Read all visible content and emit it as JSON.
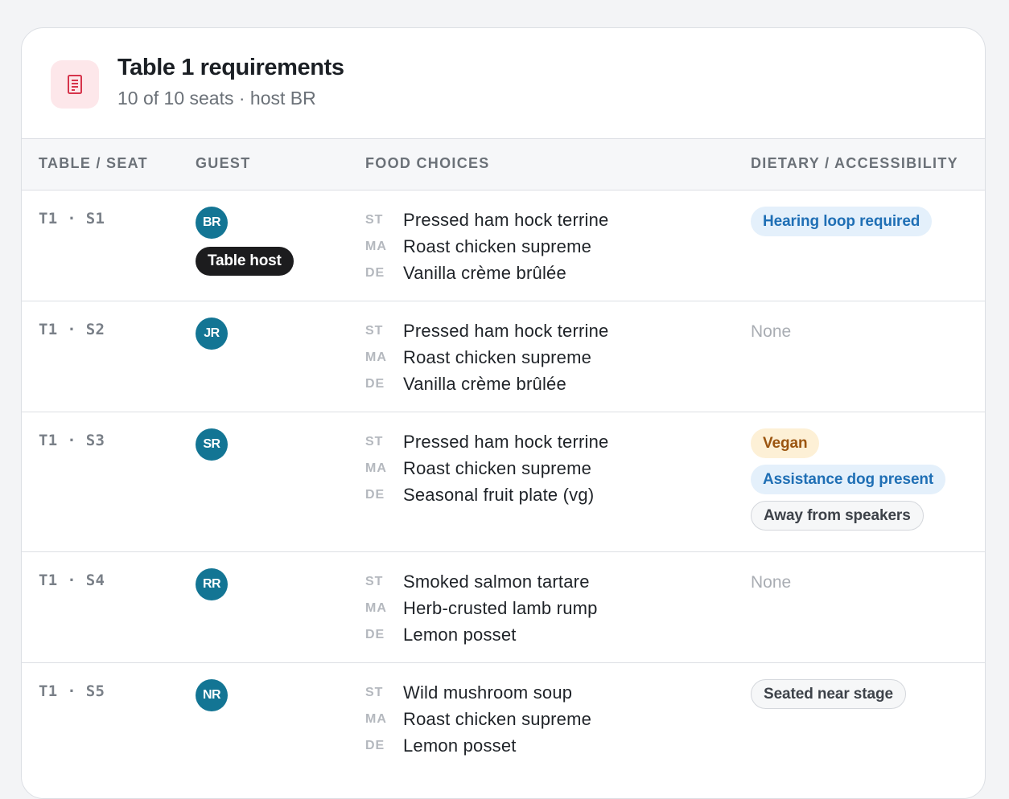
{
  "header": {
    "title": "Table 1 requirements",
    "subtitle": "10 of 10 seats · host BR",
    "icon": "receipt-icon",
    "icon_color": "#d6344b"
  },
  "columns": {
    "seat": "TABLE / SEAT",
    "guest": "GUEST",
    "food": "FOOD CHOICES",
    "dietary": "DIETARY / ACCESSIBILITY"
  },
  "courses": {
    "st": "ST",
    "ma": "MA",
    "de": "DE"
  },
  "rows": [
    {
      "table": "T1",
      "seat": "S1",
      "initials": "BR",
      "badge": "Table host",
      "starter": "Pressed ham hock terrine",
      "main": "Roast chicken supreme",
      "dessert": "Vanilla crème brûlée",
      "tags": [
        "Hearing loop required"
      ],
      "none": ""
    },
    {
      "table": "T1",
      "seat": "S2",
      "initials": "JR",
      "starter": "Pressed ham hock terrine",
      "main": "Roast chicken supreme",
      "dessert": "Vanilla crème brûlée",
      "tags": [],
      "none": "None"
    },
    {
      "table": "T1",
      "seat": "S3",
      "initials": "SR",
      "starter": "Pressed ham hock terrine",
      "main": "Roast chicken supreme",
      "dessert": "Seasonal fruit plate (vg)",
      "tags": [
        "Vegan",
        "Assistance dog present",
        "Away from speakers"
      ],
      "none": ""
    },
    {
      "table": "T1",
      "seat": "S4",
      "initials": "RR",
      "starter": "Smoked salmon tartare",
      "main": "Herb-crusted lamb rump",
      "dessert": "Lemon posset",
      "tags": [],
      "none": "None"
    },
    {
      "table": "T1",
      "seat": "S5",
      "initials": "NR",
      "starter": "Wild mushroom soup",
      "main": "Roast chicken supreme",
      "dessert": "Lemon posset",
      "tags": [
        "Seated near stage"
      ],
      "none": ""
    }
  ],
  "colors": {
    "avatar": "#137594",
    "tag_blue_bg": "#e4f0fb",
    "tag_blue_text": "#1f6fb5",
    "tag_amber_bg": "#fdf0d6",
    "tag_amber_text": "#9b5510"
  }
}
